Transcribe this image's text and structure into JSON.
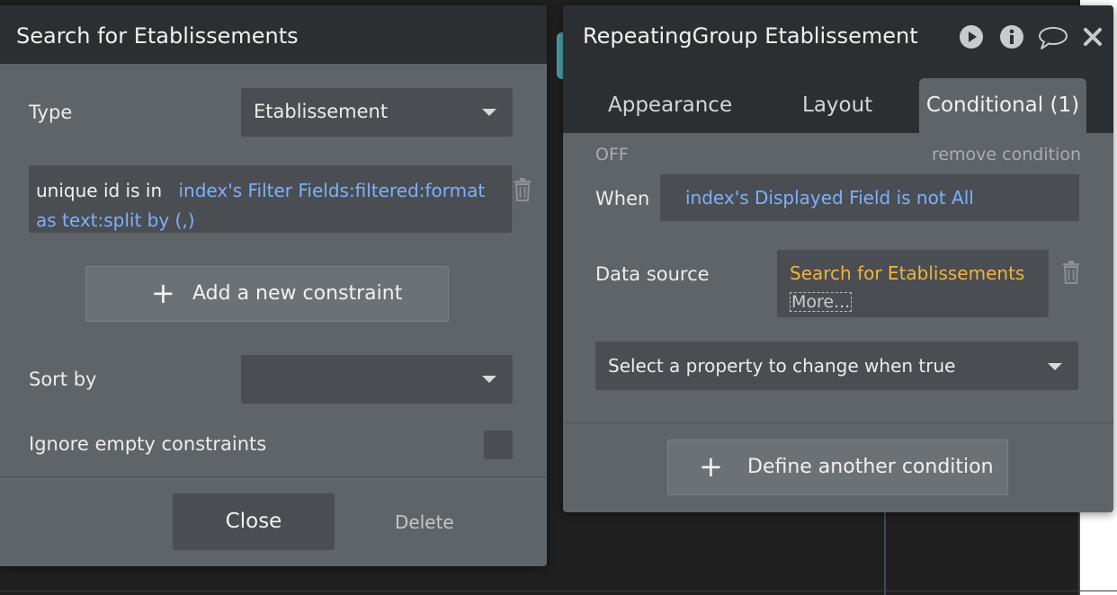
{
  "search_panel": {
    "title": "Search for Etablissements",
    "type_label": "Type",
    "type_value": "Etablissement",
    "constraint_prefix": "unique id is in",
    "constraint_expression": "index's Filter Fields:filtered:format as text:split by (,)",
    "add_constraint_label": "Add a new constraint",
    "sort_by_label": "Sort by",
    "sort_by_value": "",
    "ignore_empty_label": "Ignore empty constraints",
    "close_label": "Close",
    "delete_label": "Delete"
  },
  "property_panel": {
    "title": "RepeatingGroup Etablissement",
    "icons": [
      "play-icon",
      "info-icon",
      "comment-icon",
      "close-icon"
    ],
    "tabs": [
      {
        "label": "Appearance",
        "active": false
      },
      {
        "label": "Layout",
        "active": false
      },
      {
        "label": "Conditional (1)",
        "active": true
      }
    ],
    "condition": {
      "state": "OFF",
      "remove_label": "remove condition",
      "when_label": "When",
      "when_expression": "index's Displayed Field is not All",
      "data_source_label": "Data source",
      "data_source_value": "Search for Etablissements",
      "more_label": "More...",
      "property_select_placeholder": "Select a property to change when true"
    },
    "define_condition_label": "Define another condition"
  },
  "colors": {
    "panel_bg": "#5f6468",
    "header_bg": "#2c2f32",
    "field_bg": "#4a4e52",
    "expression_blue": "#7bb0ff",
    "data_source_orange": "#f0b43c"
  }
}
